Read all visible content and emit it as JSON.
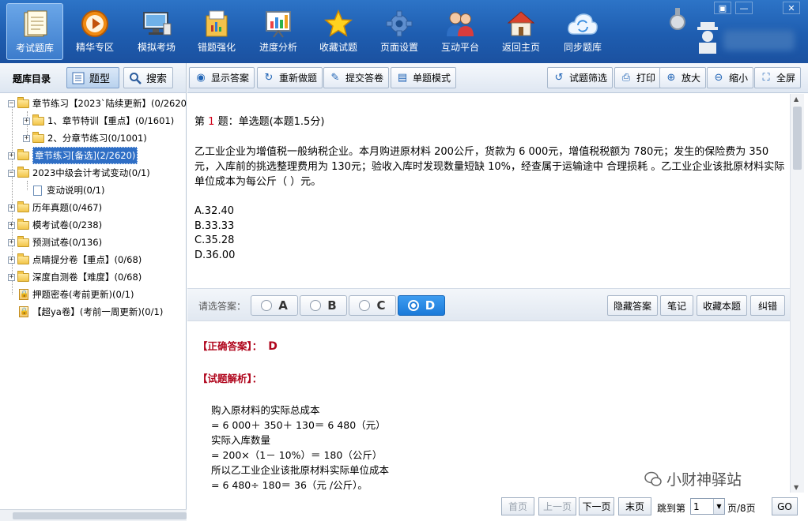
{
  "toolbar": {
    "items": [
      {
        "label": "考试题库",
        "icon": "book-icon"
      },
      {
        "label": "精华专区",
        "icon": "play-icon"
      },
      {
        "label": "模拟考场",
        "icon": "monitor-icon"
      },
      {
        "label": "错题强化",
        "icon": "folder-chart-icon"
      },
      {
        "label": "进度分析",
        "icon": "bar-chart-icon"
      },
      {
        "label": "收藏试题",
        "icon": "star-icon"
      },
      {
        "label": "页面设置",
        "icon": "gear-icon"
      },
      {
        "label": "互动平台",
        "icon": "users-icon"
      },
      {
        "label": "返回主页",
        "icon": "home-icon"
      },
      {
        "label": "同步题库",
        "icon": "cloud-sync-icon"
      }
    ],
    "window_buttons": [
      "▣",
      "—",
      "✕"
    ]
  },
  "left": {
    "title": "题库目录",
    "btn_type": "题型",
    "btn_search": "搜索",
    "tree": [
      {
        "label": "章节练习【2023`陆续更新】(0/2620",
        "type": "folder",
        "toggle": "−"
      },
      {
        "label": "1、章节特训【重点】(0/1601)",
        "type": "folder",
        "toggle": "+"
      },
      {
        "label": "2、分章节练习(0/1001)",
        "type": "folder",
        "toggle": "+"
      },
      {
        "label": "章节练习[备选](2/2620)",
        "type": "folder",
        "toggle": "+",
        "selected": true
      },
      {
        "label": "2023中级会计考试变动(0/1)",
        "type": "folder",
        "toggle": "−"
      },
      {
        "label": "变动说明(0/1)",
        "type": "doc"
      },
      {
        "label": "历年真题(0/467)",
        "type": "folder",
        "toggle": "+"
      },
      {
        "label": "模考试卷(0/238)",
        "type": "folder",
        "toggle": "+"
      },
      {
        "label": "预测试卷(0/136)",
        "type": "folder",
        "toggle": "+"
      },
      {
        "label": "点睛提分卷【重点】(0/68)",
        "type": "folder",
        "toggle": "+"
      },
      {
        "label": "深度自测卷【难度】(0/68)",
        "type": "folder",
        "toggle": "+"
      },
      {
        "label": "押题密卷(考前更新)(0/1)",
        "type": "lock"
      },
      {
        "label": "【超ya卷】(考前一周更新)(0/1)",
        "type": "lock"
      }
    ]
  },
  "qtoolbar": {
    "show_answer": "显示答案",
    "redo": "重新做题",
    "submit": "提交答卷",
    "single_mode": "单题模式",
    "filter": "试题筛选",
    "print": "打印",
    "zoom_in": "放大",
    "zoom_out": "缩小",
    "fullscreen": "全屏"
  },
  "question": {
    "prefix": "第",
    "number": "1",
    "suffix": "题：单选题(本题1.5分)",
    "stem": "乙工业企业为增值税一般纳税企业。本月购进原材料 200公斤，货款为 6 000元，增值税税额为 780元；发生的保险费为 350元，入库前的挑选整理费用为 130元；验收入库时发现数量短缺 10%，经查属于运输途中 合理损耗 。乙工业企业该批原材料实际单位成本为每公斤（ ）元。",
    "options": [
      "A.32.40",
      "B.33.33",
      "C.35.28",
      "D.36.00"
    ]
  },
  "answer_bar": {
    "prompt": "请选答案：",
    "choices": [
      "A",
      "B",
      "C",
      "D"
    ],
    "selected": "D",
    "hide_answer": "隐藏答案",
    "notes": "笔记",
    "favorite": "收藏本题",
    "correct_error": "纠错"
  },
  "analysis": {
    "correct_label": "【正确答案】：",
    "correct_value": "D",
    "analysis_label": "【试题解析】：",
    "lines": [
      "购入原材料的实际总成本",
      "= 6 000＋ 350＋ 130＝ 6 480（元）",
      "实际入库数量",
      "= 200×（1－ 10%）＝ 180（公斤）",
      "所以乙工业企业该批原材料实际单位成本",
      "= 6 480÷ 180＝ 36（元 /公斤）。"
    ]
  },
  "pager": {
    "first": "首页",
    "prev": "上一页",
    "next": "下一页",
    "last": "末页",
    "jump_label": "跳到第",
    "page_value": "1",
    "page_suffix": "页/8页",
    "go": "GO"
  },
  "watermark": "小财神驿站"
}
